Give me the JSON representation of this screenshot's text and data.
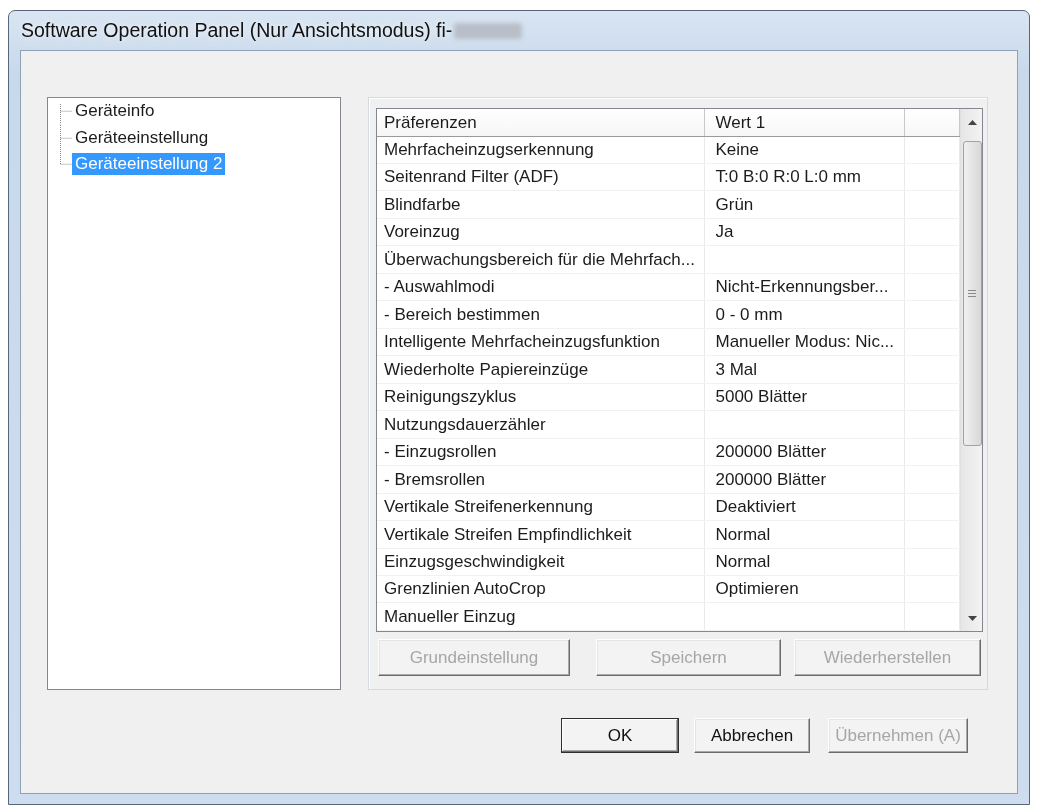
{
  "window": {
    "title": "Software Operation Panel (Nur Ansichtsmodus) fi-",
    "title_redacted": true
  },
  "tree": {
    "items": [
      {
        "label": "Geräteinfo",
        "selected": false
      },
      {
        "label": "Geräteeinstellung",
        "selected": false
      },
      {
        "label": "Geräteeinstellung 2",
        "selected": true
      }
    ]
  },
  "table": {
    "columns": [
      "Präferenzen",
      "Wert 1"
    ],
    "rows": [
      {
        "name": "Mehrfacheinzugserkennung",
        "value": "Keine"
      },
      {
        "name": "Seitenrand Filter (ADF)",
        "value": "T:0 B:0 R:0 L:0 mm"
      },
      {
        "name": "Blindfarbe",
        "value": "Grün"
      },
      {
        "name": "Voreinzug",
        "value": "Ja"
      },
      {
        "name": "Überwachungsbereich für die Mehrfach..."
      },
      {
        "name": "- Auswahlmodi",
        "value": "Nicht-Erkennungsber..."
      },
      {
        "name": "- Bereich bestimmen",
        "value": "0 - 0 mm"
      },
      {
        "name": "Intelligente Mehrfacheinzugsfunktion",
        "value": "Manueller Modus: Nic..."
      },
      {
        "name": "Wiederholte Papiereinzüge",
        "value": "3 Mal"
      },
      {
        "name": "Reinigungszyklus",
        "value": "5000 Blätter"
      },
      {
        "name": "Nutzungsdauerzähler"
      },
      {
        "name": "- Einzugsrollen",
        "value": "200000 Blätter"
      },
      {
        "name": "- Bremsrollen",
        "value": "200000 Blätter"
      },
      {
        "name": "Vertikale Streifenerkennung",
        "value": "Deaktiviert"
      },
      {
        "name": "Vertikale Streifen Empfindlichkeit",
        "value": "Normal"
      },
      {
        "name": "Einzugsgeschwindigkeit",
        "value": "Normal"
      },
      {
        "name": "Grenzlinien AutoCrop",
        "value": "Optimieren"
      },
      {
        "name": "Manueller Einzug"
      }
    ]
  },
  "panel_buttons": [
    {
      "label": "Grundeinstellung",
      "disabled": true
    },
    {
      "label": "Speichern",
      "disabled": true
    },
    {
      "label": "Wiederherstellen",
      "disabled": true
    }
  ],
  "buttons": [
    {
      "label": "OK",
      "default": true,
      "disabled": false
    },
    {
      "label": "Abbrechen",
      "default": false,
      "disabled": false
    },
    {
      "label": "Übernehmen (A)",
      "default": false,
      "disabled": true
    }
  ]
}
